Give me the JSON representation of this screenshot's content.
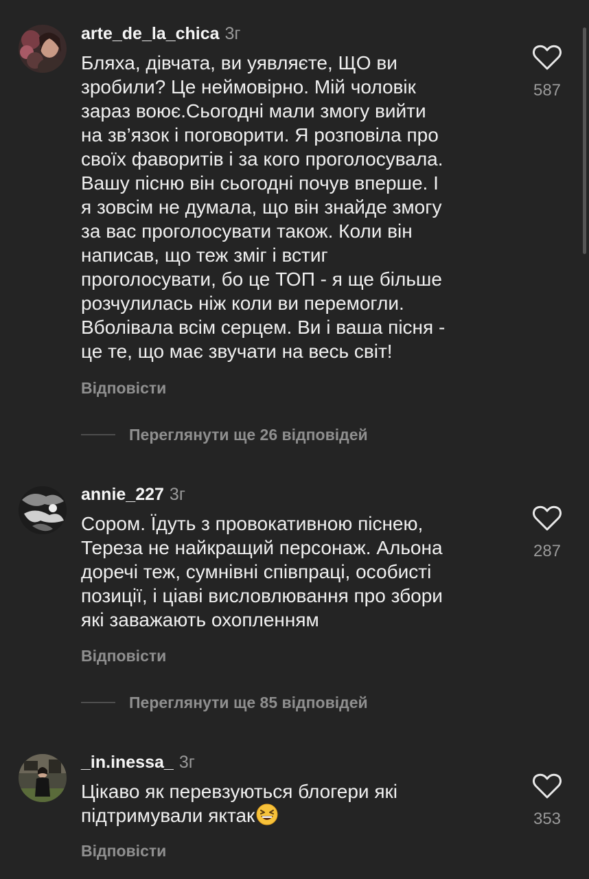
{
  "comments": [
    {
      "username": "arte_de_la_chica",
      "time": "3г",
      "text": "Бляха, дівчата, ви уявляєте, ЩО ви\nзробили? Це неймовірно. Мій чоловік\nзараз воює.Сьогодні мали змогу вийти\nна зв’язок і поговорити. Я розповіла про\nсвоїх фаворитів і за кого проголосувала.\nВашу пісню він сьогодні почув вперше. І\nя зовсім не думала, що він знайде змогу\nза вас проголосувати також. Коли він\nнаписав, що теж зміг і встиг\nпроголосувати, бо це ТОП - я ще більше\nрозчулилась ніж коли ви перемогли.\nВболівала всім серцем. Ви і ваша пісня -\nце те, що має звучати на весь світ!",
      "likes": "587",
      "reply_label": "Відповісти",
      "view_replies": "Переглянути ще 26 відповідей"
    },
    {
      "username": "annie_227",
      "time": "3г",
      "text": "Сором. Їдуть з провокативною піснею,\nТереза не найкращий персонаж. Альона\nдоречі теж, сумнівні співпраці, особисті\nпозиції, і ціаві висловлювання про збори\nякі заважають охопленням",
      "likes": "287",
      "reply_label": "Відповісти",
      "view_replies": "Переглянути ще 85 відповідей"
    },
    {
      "username": "_in.inessa_",
      "time": "3г",
      "text": "Цікаво як перевзуються блогери які\nпідтримували яктак",
      "emoji": "grinning-squinting-face",
      "likes": "353",
      "reply_label": "Відповісти"
    }
  ],
  "colors": {
    "background": "#242424",
    "text": "#f0f0f0",
    "secondary": "#8f8f8f"
  }
}
